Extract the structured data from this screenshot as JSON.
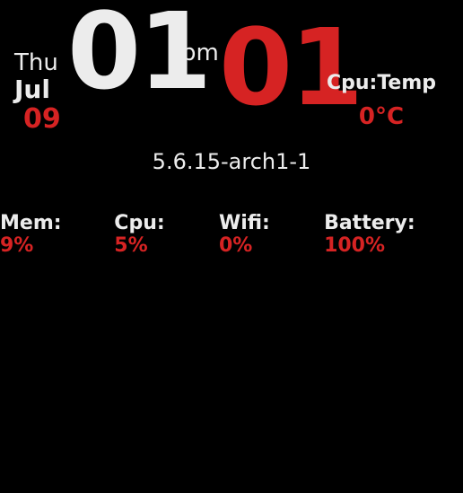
{
  "date": {
    "day_of_week": "Thu",
    "month": "Jul",
    "day_num": "09"
  },
  "time": {
    "hour": "01",
    "ampm": "pm",
    "minute": "01"
  },
  "cputemp": {
    "label": "Cpu:Temp",
    "value": "0°C"
  },
  "kernel": "5.6.15-arch1-1",
  "stats": {
    "mem": {
      "label": "Mem: ",
      "value": "9%"
    },
    "cpu": {
      "label": "Cpu: ",
      "value": "5%"
    },
    "wifi": {
      "label": "Wifi: ",
      "value": "0%"
    },
    "battery": {
      "label": "Battery: ",
      "value": "100%"
    }
  }
}
